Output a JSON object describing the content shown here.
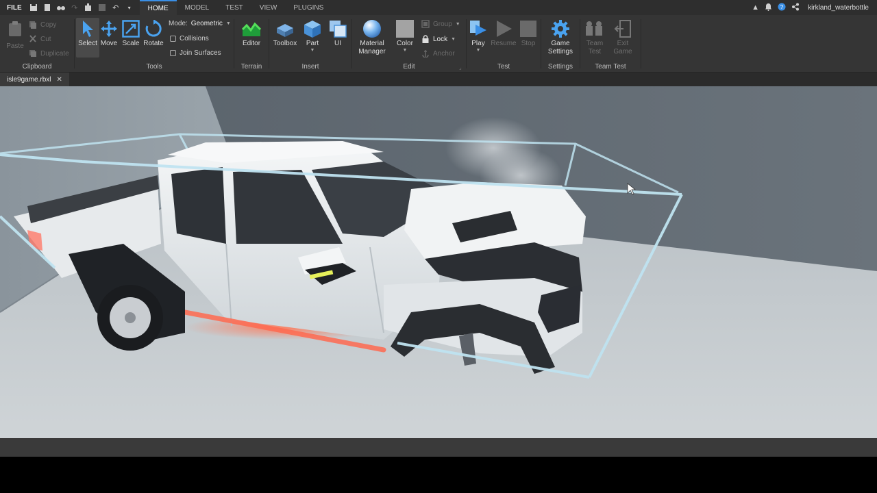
{
  "menubar": {
    "file_label": "FILE",
    "tabs": [
      {
        "label": "HOME",
        "active": true
      },
      {
        "label": "MODEL",
        "active": false
      },
      {
        "label": "TEST",
        "active": false
      },
      {
        "label": "VIEW",
        "active": false
      },
      {
        "label": "PLUGINS",
        "active": false
      }
    ],
    "username": "kirkland_waterbottle"
  },
  "ribbon": {
    "clipboard": {
      "label": "Clipboard",
      "paste": "Paste",
      "copy": "Copy",
      "cut": "Cut",
      "duplicate": "Duplicate"
    },
    "tools": {
      "label": "Tools",
      "select": "Select",
      "move": "Move",
      "scale": "Scale",
      "rotate": "Rotate",
      "mode_label": "Mode:",
      "mode_value": "Geometric",
      "collisions": "Collisions",
      "join_surfaces": "Join Surfaces"
    },
    "terrain": {
      "label": "Terrain",
      "editor": "Editor"
    },
    "insert": {
      "label": "Insert",
      "toolbox": "Toolbox",
      "part": "Part",
      "ui": "UI"
    },
    "edit": {
      "label": "Edit",
      "material_manager_1": "Material",
      "material_manager_2": "Manager",
      "color": "Color",
      "group": "Group",
      "lock": "Lock",
      "anchor": "Anchor"
    },
    "test": {
      "label": "Test",
      "play": "Play",
      "resume": "Resume",
      "stop": "Stop"
    },
    "settings": {
      "label": "Settings",
      "game_settings_1": "Game",
      "game_settings_2": "Settings"
    },
    "team_test": {
      "label": "Team Test",
      "team_test_1": "Team",
      "team_test_2": "Test",
      "exit_game_1": "Exit",
      "exit_game_2": "Game"
    }
  },
  "document_tab": {
    "name": "isle9game.rbxl",
    "close": "✕"
  },
  "colors": {
    "accent": "#3a8fe6",
    "selection_box": "#bfe3f0",
    "underglow": "#ff6a50"
  }
}
